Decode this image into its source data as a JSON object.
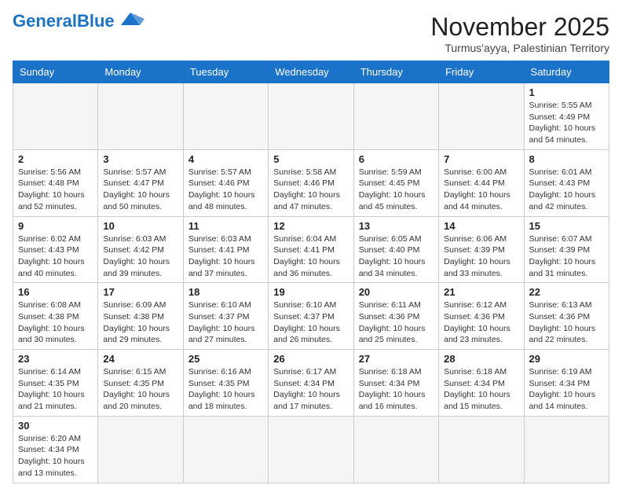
{
  "header": {
    "logo_general": "General",
    "logo_blue": "Blue",
    "month_title": "November 2025",
    "subtitle": "Turmus'ayya, Palestinian Territory"
  },
  "days_of_week": [
    "Sunday",
    "Monday",
    "Tuesday",
    "Wednesday",
    "Thursday",
    "Friday",
    "Saturday"
  ],
  "weeks": [
    [
      {
        "day": "",
        "info": ""
      },
      {
        "day": "",
        "info": ""
      },
      {
        "day": "",
        "info": ""
      },
      {
        "day": "",
        "info": ""
      },
      {
        "day": "",
        "info": ""
      },
      {
        "day": "",
        "info": ""
      },
      {
        "day": "1",
        "info": "Sunrise: 5:55 AM\nSunset: 4:49 PM\nDaylight: 10 hours and 54 minutes."
      }
    ],
    [
      {
        "day": "2",
        "info": "Sunrise: 5:56 AM\nSunset: 4:48 PM\nDaylight: 10 hours and 52 minutes."
      },
      {
        "day": "3",
        "info": "Sunrise: 5:57 AM\nSunset: 4:47 PM\nDaylight: 10 hours and 50 minutes."
      },
      {
        "day": "4",
        "info": "Sunrise: 5:57 AM\nSunset: 4:46 PM\nDaylight: 10 hours and 48 minutes."
      },
      {
        "day": "5",
        "info": "Sunrise: 5:58 AM\nSunset: 4:46 PM\nDaylight: 10 hours and 47 minutes."
      },
      {
        "day": "6",
        "info": "Sunrise: 5:59 AM\nSunset: 4:45 PM\nDaylight: 10 hours and 45 minutes."
      },
      {
        "day": "7",
        "info": "Sunrise: 6:00 AM\nSunset: 4:44 PM\nDaylight: 10 hours and 44 minutes."
      },
      {
        "day": "8",
        "info": "Sunrise: 6:01 AM\nSunset: 4:43 PM\nDaylight: 10 hours and 42 minutes."
      }
    ],
    [
      {
        "day": "9",
        "info": "Sunrise: 6:02 AM\nSunset: 4:43 PM\nDaylight: 10 hours and 40 minutes."
      },
      {
        "day": "10",
        "info": "Sunrise: 6:03 AM\nSunset: 4:42 PM\nDaylight: 10 hours and 39 minutes."
      },
      {
        "day": "11",
        "info": "Sunrise: 6:03 AM\nSunset: 4:41 PM\nDaylight: 10 hours and 37 minutes."
      },
      {
        "day": "12",
        "info": "Sunrise: 6:04 AM\nSunset: 4:41 PM\nDaylight: 10 hours and 36 minutes."
      },
      {
        "day": "13",
        "info": "Sunrise: 6:05 AM\nSunset: 4:40 PM\nDaylight: 10 hours and 34 minutes."
      },
      {
        "day": "14",
        "info": "Sunrise: 6:06 AM\nSunset: 4:39 PM\nDaylight: 10 hours and 33 minutes."
      },
      {
        "day": "15",
        "info": "Sunrise: 6:07 AM\nSunset: 4:39 PM\nDaylight: 10 hours and 31 minutes."
      }
    ],
    [
      {
        "day": "16",
        "info": "Sunrise: 6:08 AM\nSunset: 4:38 PM\nDaylight: 10 hours and 30 minutes."
      },
      {
        "day": "17",
        "info": "Sunrise: 6:09 AM\nSunset: 4:38 PM\nDaylight: 10 hours and 29 minutes."
      },
      {
        "day": "18",
        "info": "Sunrise: 6:10 AM\nSunset: 4:37 PM\nDaylight: 10 hours and 27 minutes."
      },
      {
        "day": "19",
        "info": "Sunrise: 6:10 AM\nSunset: 4:37 PM\nDaylight: 10 hours and 26 minutes."
      },
      {
        "day": "20",
        "info": "Sunrise: 6:11 AM\nSunset: 4:36 PM\nDaylight: 10 hours and 25 minutes."
      },
      {
        "day": "21",
        "info": "Sunrise: 6:12 AM\nSunset: 4:36 PM\nDaylight: 10 hours and 23 minutes."
      },
      {
        "day": "22",
        "info": "Sunrise: 6:13 AM\nSunset: 4:36 PM\nDaylight: 10 hours and 22 minutes."
      }
    ],
    [
      {
        "day": "23",
        "info": "Sunrise: 6:14 AM\nSunset: 4:35 PM\nDaylight: 10 hours and 21 minutes."
      },
      {
        "day": "24",
        "info": "Sunrise: 6:15 AM\nSunset: 4:35 PM\nDaylight: 10 hours and 20 minutes."
      },
      {
        "day": "25",
        "info": "Sunrise: 6:16 AM\nSunset: 4:35 PM\nDaylight: 10 hours and 18 minutes."
      },
      {
        "day": "26",
        "info": "Sunrise: 6:17 AM\nSunset: 4:34 PM\nDaylight: 10 hours and 17 minutes."
      },
      {
        "day": "27",
        "info": "Sunrise: 6:18 AM\nSunset: 4:34 PM\nDaylight: 10 hours and 16 minutes."
      },
      {
        "day": "28",
        "info": "Sunrise: 6:18 AM\nSunset: 4:34 PM\nDaylight: 10 hours and 15 minutes."
      },
      {
        "day": "29",
        "info": "Sunrise: 6:19 AM\nSunset: 4:34 PM\nDaylight: 10 hours and 14 minutes."
      }
    ],
    [
      {
        "day": "30",
        "info": "Sunrise: 6:20 AM\nSunset: 4:34 PM\nDaylight: 10 hours and 13 minutes."
      },
      {
        "day": "",
        "info": ""
      },
      {
        "day": "",
        "info": ""
      },
      {
        "day": "",
        "info": ""
      },
      {
        "day": "",
        "info": ""
      },
      {
        "day": "",
        "info": ""
      },
      {
        "day": "",
        "info": ""
      }
    ]
  ]
}
